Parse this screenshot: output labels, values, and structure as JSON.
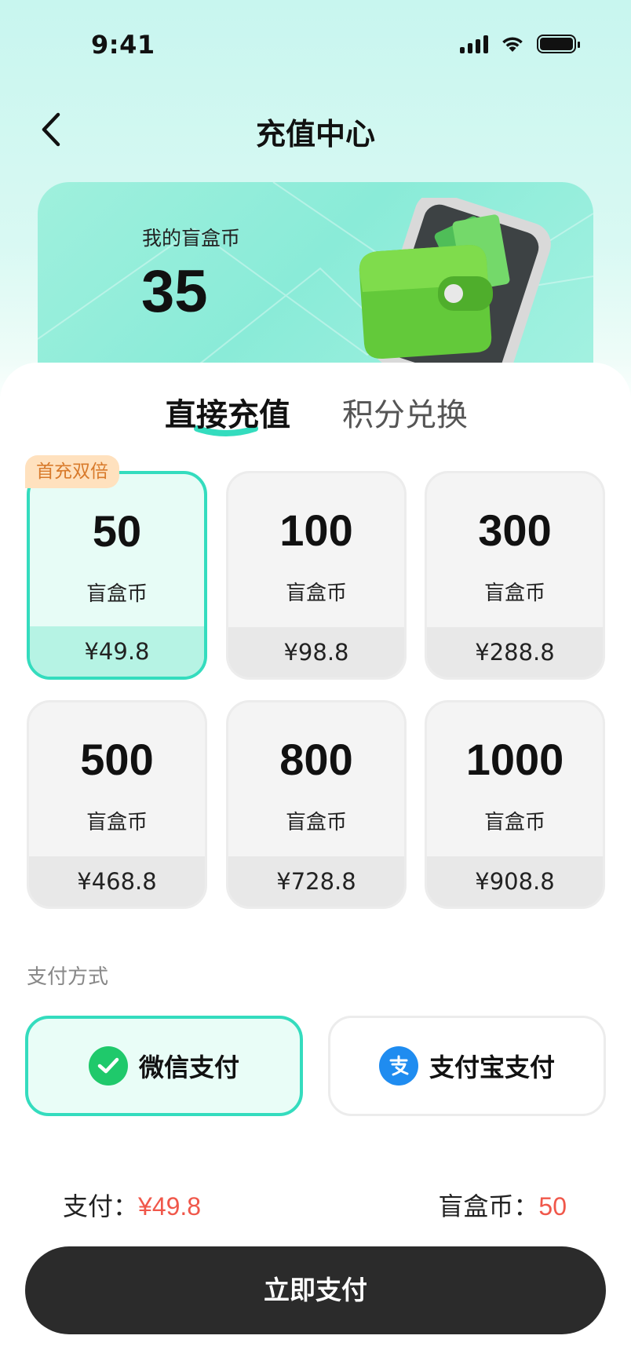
{
  "status_bar": {
    "time": "9:41"
  },
  "nav": {
    "title": "充值中心"
  },
  "balance": {
    "label": "我的盲盒币",
    "value": "35"
  },
  "tabs": [
    {
      "label": "直接充值",
      "active": true
    },
    {
      "label": "积分兑换",
      "active": false
    }
  ],
  "packages": [
    {
      "amount": "50",
      "unit": "盲盒币",
      "price": "¥49.8",
      "selected": true,
      "badge": "首充双倍"
    },
    {
      "amount": "100",
      "unit": "盲盒币",
      "price": "¥98.8",
      "selected": false
    },
    {
      "amount": "300",
      "unit": "盲盒币",
      "price": "¥288.8",
      "selected": false
    },
    {
      "amount": "500",
      "unit": "盲盒币",
      "price": "¥468.8",
      "selected": false
    },
    {
      "amount": "800",
      "unit": "盲盒币",
      "price": "¥728.8",
      "selected": false
    },
    {
      "amount": "1000",
      "unit": "盲盒币",
      "price": "¥908.8",
      "selected": false
    }
  ],
  "payment": {
    "section_label": "支付方式",
    "options": [
      {
        "label": "微信支付",
        "icon": "wechat-icon",
        "selected": true
      },
      {
        "label": "支付宝支付",
        "icon": "alipay-icon",
        "selected": false
      }
    ]
  },
  "summary": {
    "pay_label": "支付：",
    "pay_value": "¥49.8",
    "coin_label": "盲盒币：",
    "coin_value": "50"
  },
  "actions": {
    "pay_now": "立即支付"
  },
  "colors": {
    "accent": "#34dcbe",
    "price_red": "#f0574a",
    "button_dark": "#2b2b2b",
    "badge_bg": "#ffe1be",
    "badge_text": "#d87a2b",
    "wechat_green": "#1fc96b",
    "alipay_blue": "#1f8cf0"
  }
}
